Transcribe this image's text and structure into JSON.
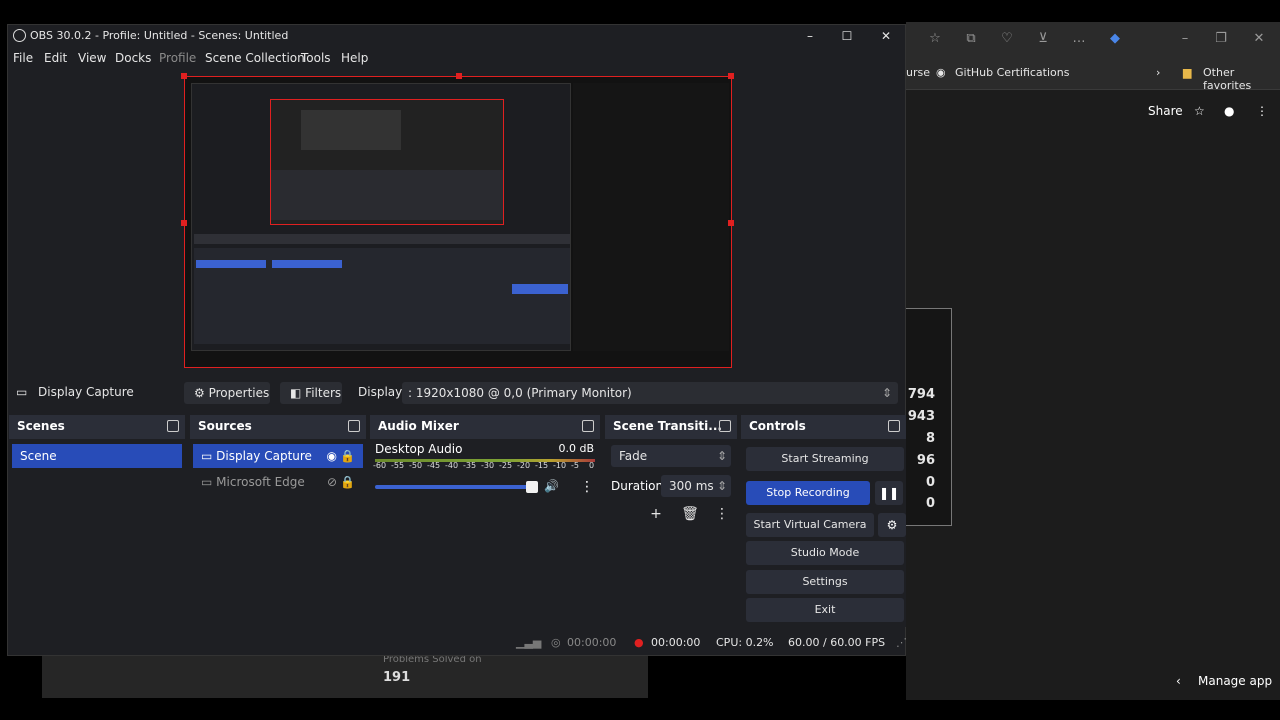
{
  "obs": {
    "window_title": "OBS 30.0.2 - Profile: Untitled - Scenes: Untitled",
    "menu": [
      "File",
      "Edit",
      "View",
      "Docks",
      "Profile",
      "Scene Collection",
      "Tools",
      "Help"
    ],
    "source_bar": {
      "source_name": "Display Capture",
      "properties_label": "Properties",
      "filters_label": "Filters",
      "display_label": "Display",
      "display_value": ": 1920x1080 @ 0,0 (Primary Monitor)"
    },
    "scenes": {
      "title": "Scenes",
      "items": [
        "Scene"
      ]
    },
    "sources": {
      "title": "Sources",
      "items": [
        "Display Capture",
        "Microsoft Edge"
      ]
    },
    "audio_mixer": {
      "title": "Audio Mixer",
      "channel": "Desktop Audio",
      "level": "0.0 dB",
      "scale": [
        "-60",
        "-55",
        "-50",
        "-45",
        "-40",
        "-35",
        "-30",
        "-25",
        "-20",
        "-15",
        "-10",
        "-5",
        "0"
      ]
    },
    "transitions": {
      "title": "Scene Transiti...",
      "type": "Fade",
      "duration_label": "Duration",
      "duration_value": "300 ms"
    },
    "controls": {
      "title": "Controls",
      "start_streaming": "Start Streaming",
      "stop_recording": "Stop Recording",
      "start_virtual_camera": "Start Virtual Camera",
      "studio_mode": "Studio Mode",
      "settings": "Settings",
      "exit": "Exit"
    },
    "status": {
      "stream_time": "00:00:00",
      "record_time": "00:00:00",
      "cpu": "CPU: 0.2%",
      "fps": "60.00 / 60.00 FPS"
    }
  },
  "browser": {
    "favorites": {
      "partial": "urse",
      "github_cert": "GitHub Certifications",
      "other": "Other favorites"
    },
    "share_label": "Share",
    "stats": [
      "794",
      "943",
      "8",
      "96",
      "0",
      "0"
    ],
    "manage_app": "Manage app",
    "problems_label": "Problems Solved on",
    "problems_value": "191"
  },
  "colors": {
    "accent": "#284cb8",
    "record_red": "#e02020",
    "panel": "#272a33"
  }
}
